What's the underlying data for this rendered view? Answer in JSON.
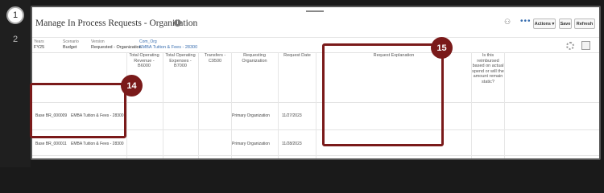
{
  "steps": [
    "1",
    "2"
  ],
  "header": {
    "title": "Manage In Process Requests - Organization",
    "info_icon": "info-icon",
    "toolbar": {
      "more": "•••",
      "actions": "Actions ▾",
      "save": "Save",
      "refresh": "Refresh"
    }
  },
  "pov": [
    {
      "label": "Years",
      "value": "FY25"
    },
    {
      "label": "Scenario",
      "value": "Budget"
    },
    {
      "label": "Version",
      "value": "Requested - Organization"
    },
    {
      "label": "Com_Org",
      "value": "EMBA Tuition & Fees - 28300"
    }
  ],
  "grid": {
    "columns": [
      "Total Operating Revenue - B6000",
      "Total Operating Expenses - B7000",
      "Transfers - C9500",
      "Requesting Organization",
      "Request Date",
      "Request Explanation",
      "Is this reimbursed based on actual spend or will the amount remain static?"
    ],
    "rows": [
      {
        "request": "Base BR_000009",
        "org": "EMBA Tuition & Fees - 28300",
        "requesting_org": "Primary Organization",
        "date": "11/27/2023"
      },
      {
        "request": "Base BR_000011",
        "org": "EMBA Tuition & Fees - 28300",
        "requesting_org": "Primary Organization",
        "date": "11/28/2023"
      }
    ]
  },
  "callouts": [
    {
      "number": "14"
    },
    {
      "number": "15"
    }
  ],
  "colors": {
    "callout": "#7a1a1a",
    "link": "#3a6fb0"
  }
}
